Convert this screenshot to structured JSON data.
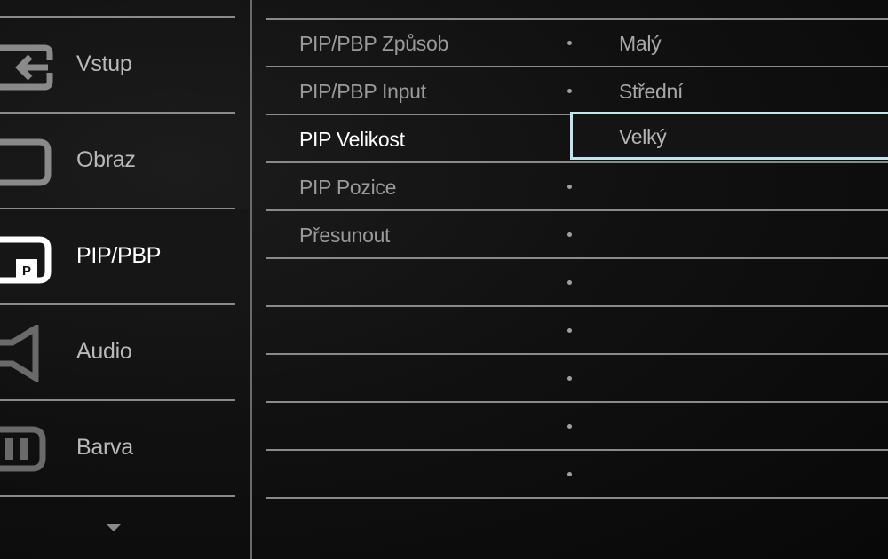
{
  "sidebar": {
    "items": [
      {
        "label": "Vstup",
        "icon": "input-icon",
        "active": false
      },
      {
        "label": "Obraz",
        "icon": "picture-icon",
        "active": false
      },
      {
        "label": "PIP/PBP",
        "icon": "pip-icon",
        "active": true
      },
      {
        "label": "Audio",
        "icon": "speaker-icon",
        "active": false
      },
      {
        "label": "Barva",
        "icon": "color-icon",
        "active": false
      }
    ],
    "more_icon": "chevron-down-icon"
  },
  "settings": {
    "rows": [
      {
        "label": "PIP/PBP Způsob",
        "option": "Malý"
      },
      {
        "label": "PIP/PBP Input",
        "option": "Střední"
      },
      {
        "label": "PIP Velikost",
        "option": "Velký",
        "active": true,
        "option_selected": true
      },
      {
        "label": "PIP Pozice",
        "option": ""
      },
      {
        "label": "Přesunout",
        "option": ""
      },
      {
        "label": "",
        "option": ""
      },
      {
        "label": "",
        "option": ""
      },
      {
        "label": "",
        "option": ""
      },
      {
        "label": "",
        "option": ""
      },
      {
        "label": "",
        "option": ""
      }
    ]
  },
  "colors": {
    "selection_border": "#bfe6ee",
    "active_text": "#ffffff",
    "inactive_text": "#9a9a9a",
    "separator": "#8a8a8a"
  }
}
